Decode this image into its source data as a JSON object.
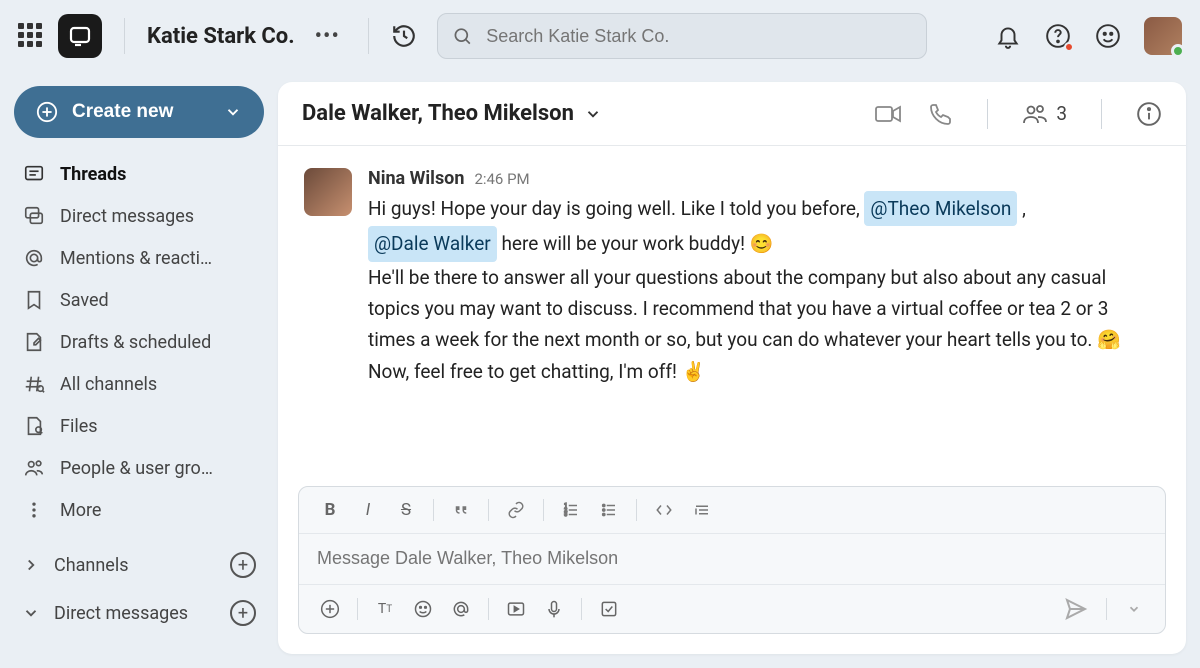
{
  "header": {
    "workspace_name": "Katie Stark Co.",
    "search_placeholder": "Search Katie Stark Co."
  },
  "sidebar": {
    "create_label": "Create new",
    "items": [
      {
        "label": "Threads",
        "active": true,
        "icon": "thread-icon"
      },
      {
        "label": "Direct messages",
        "active": false,
        "icon": "dm-icon"
      },
      {
        "label": "Mentions & reacti…",
        "active": false,
        "icon": "mention-icon"
      },
      {
        "label": "Saved",
        "active": false,
        "icon": "bookmark-icon"
      },
      {
        "label": "Drafts & scheduled",
        "active": false,
        "icon": "draft-icon"
      },
      {
        "label": "All channels",
        "active": false,
        "icon": "channels-icon"
      },
      {
        "label": "Files",
        "active": false,
        "icon": "files-icon"
      },
      {
        "label": "People & user gro…",
        "active": false,
        "icon": "people-icon"
      },
      {
        "label": "More",
        "active": false,
        "icon": "more-icon"
      }
    ],
    "sections": {
      "channels": "Channels",
      "dms": "Direct messages"
    }
  },
  "chat": {
    "title": "Dale Walker, Theo Mikelson",
    "member_count": "3",
    "message": {
      "author": "Nina Wilson",
      "time": "2:46 PM",
      "line1_pre": "Hi guys! Hope your day is going well. Like I told you before, ",
      "mention1": "@Theo Mikelson",
      "line1_post": " , ",
      "mention2": "@Dale Walker",
      "line2_post": "  here will be your work buddy! 😊",
      "line3": "He'll be there to answer all your questions about the company but also about any casual topics you may want to discuss. I recommend that you have a virtual coffee or tea 2 or 3 times a week for the next month or so, but you can do whatever your heart tells you to. 🤗",
      "line4": "Now, feel free to get chatting, I'm off! ✌️"
    },
    "composer_placeholder": "Message Dale Walker, Theo Mikelson"
  }
}
